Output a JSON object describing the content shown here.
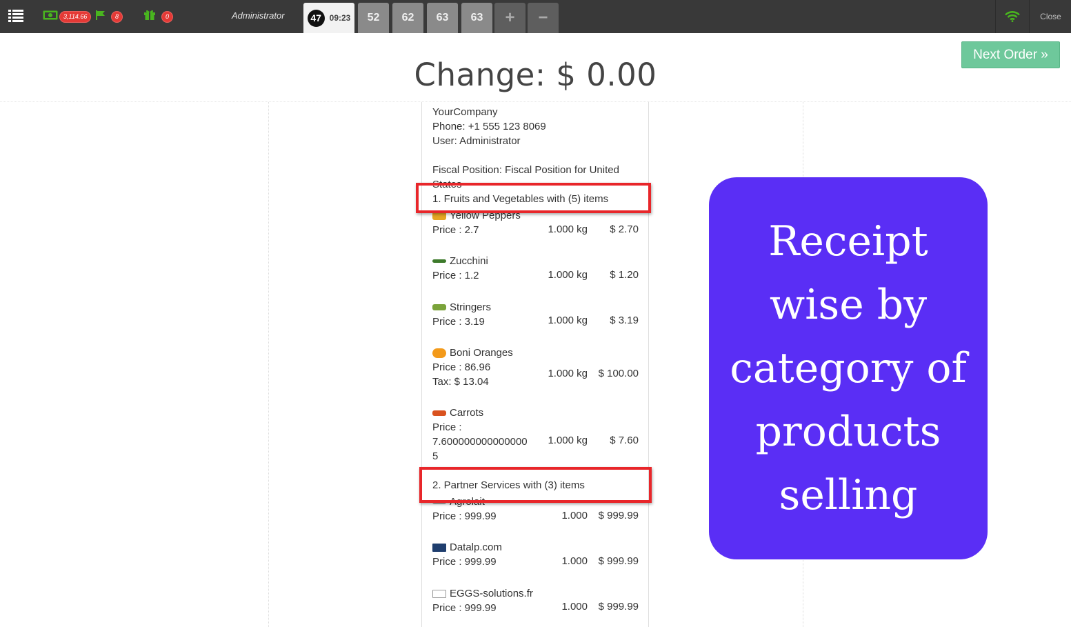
{
  "topbar": {
    "menu_icon": "list-icon",
    "cash_icon": "cash-icon",
    "cash_amount": "3,114.66",
    "flag_icon": "flag-icon",
    "flag_count": "8",
    "gift_icon": "gift-icon",
    "gift_count": "0",
    "user": "Administrator",
    "active_order": {
      "sequence": "47",
      "time": "09:23"
    },
    "orders": [
      "52",
      "62",
      "63",
      "63"
    ],
    "add_label": "+",
    "remove_label": "−",
    "wifi_icon": "wifi-icon",
    "close_label": "Close",
    "accent_color": "#49b51f",
    "badge_color": "#e53935"
  },
  "screen": {
    "change_text": "Change: $ 0.00",
    "next_order_label": "Next Order »",
    "next_order_color": "#6ec89b"
  },
  "receipt": {
    "company": "YourCompany",
    "phone": "Phone: +1 555 123 8069",
    "user": "User: Administrator",
    "fiscal_position": "Fiscal Position: Fiscal Position for United",
    "fiscal_position_cont": "States",
    "categories": [
      {
        "title": "1. Fruits and Vegetables with (5) items",
        "items": [
          {
            "name": "Yellow Peppers",
            "price": "Price : 2.7",
            "qty": "1.000 kg",
            "amount": "$ 2.70",
            "icon": "yellow-peppers-thumb"
          },
          {
            "name": "Zucchini",
            "price": "Price : 1.2",
            "qty": "1.000 kg",
            "amount": "$ 1.20",
            "icon": "zucchini-thumb"
          },
          {
            "name": "Stringers",
            "price": "Price : 3.19",
            "qty": "1.000 kg",
            "amount": "$ 3.19",
            "icon": "stringers-thumb"
          },
          {
            "name": "Boni Oranges",
            "price": "Price : 86.96",
            "tax": "Tax: $ 13.04",
            "qty": "1.000 kg",
            "amount": "$ 100.00",
            "icon": "oranges-thumb"
          },
          {
            "name": "Carrots",
            "price": "Price :",
            "price_cont": "7.600000000000000",
            "price_cont2": "5",
            "qty": "1.000 kg",
            "amount": "$ 7.60",
            "icon": "carrots-thumb"
          }
        ]
      },
      {
        "title": "2. Partner Services with (3) items",
        "items": [
          {
            "name": "Agrolait",
            "price": "Price : 999.99",
            "qty": "1.000",
            "amount": "$ 999.99",
            "icon": "agrolait-thumb"
          },
          {
            "name": "Datalp.com",
            "price": "Price : 999.99",
            "qty": "1.000",
            "amount": "$ 999.99",
            "icon": "datalp-thumb"
          },
          {
            "name": "EGGS-solutions.fr",
            "price": "Price : 999.99",
            "qty": "1.000",
            "amount": "$ 999.99",
            "icon": "eggs-thumb"
          }
        ]
      }
    ],
    "highlight_color": "#e8262a"
  },
  "promo": {
    "text": "Receipt wise by category of products selling",
    "background": "#5a2ef5"
  }
}
